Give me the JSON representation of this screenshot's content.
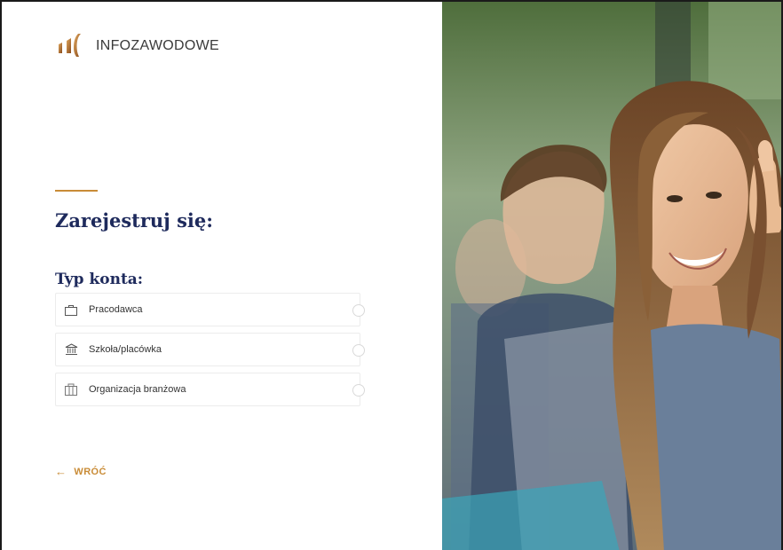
{
  "brand": {
    "name": "INFOZAWODOWE",
    "colors": {
      "accent": "#c98c37",
      "navy": "#1e2a5c"
    }
  },
  "register": {
    "title": "Zarejestruj się:",
    "account_type_label": "Typ konta:",
    "options": [
      {
        "label": "Pracodawca",
        "icon": "briefcase-icon"
      },
      {
        "label": "Szkoła/placówka",
        "icon": "school-building-icon"
      },
      {
        "label": "Organizacja branżowa",
        "icon": "organization-building-icon"
      }
    ],
    "back_label": "WRÓĆ",
    "back_icon": "arrow-left-icon"
  },
  "photo": {
    "description_icon": "students-photo"
  }
}
